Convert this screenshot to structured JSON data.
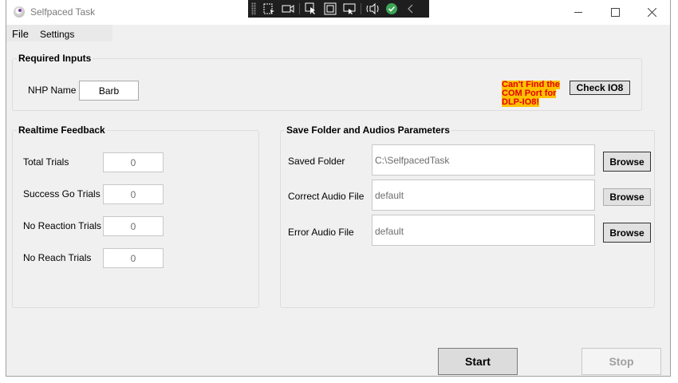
{
  "window": {
    "title": "Selfpaced Task"
  },
  "floating_toolbar": {
    "icons": [
      "select-region-icon",
      "record-video-icon",
      "pointer-icon",
      "window-capture-icon",
      "screen-capture-icon",
      "audio-icon",
      "check-icon",
      "collapse-icon"
    ]
  },
  "menu": {
    "file": "File",
    "settings": "Settings"
  },
  "required_inputs": {
    "legend": "Required Inputs",
    "nhp_label": "NHP Name",
    "nhp_value": "Barb",
    "warning": "Can't Find the COM Port for DLP-IO8!",
    "check_button": "Check IO8",
    "warning_colors": {
      "text": "#e00000",
      "highlight": "#ffc000"
    }
  },
  "realtime_feedback": {
    "legend": "Realtime Feedback",
    "rows": [
      {
        "label": "Total Trials",
        "value": "0"
      },
      {
        "label": "Success Go Trials",
        "value": "0"
      },
      {
        "label": "No Reaction Trials",
        "value": "0"
      },
      {
        "label": "No Reach Trials",
        "value": "0"
      }
    ]
  },
  "save_folder": {
    "legend": "Save Folder and Audios Parameters",
    "rows": [
      {
        "label": "Saved Folder",
        "value": "C:\\SelfpacedTask",
        "button": "Browse"
      },
      {
        "label": "Correct Audio File",
        "value": "default",
        "button": "Browse"
      },
      {
        "label": "Error Audio File",
        "value": "default",
        "button": "Browse"
      }
    ]
  },
  "actions": {
    "start": "Start",
    "stop": "Stop"
  }
}
